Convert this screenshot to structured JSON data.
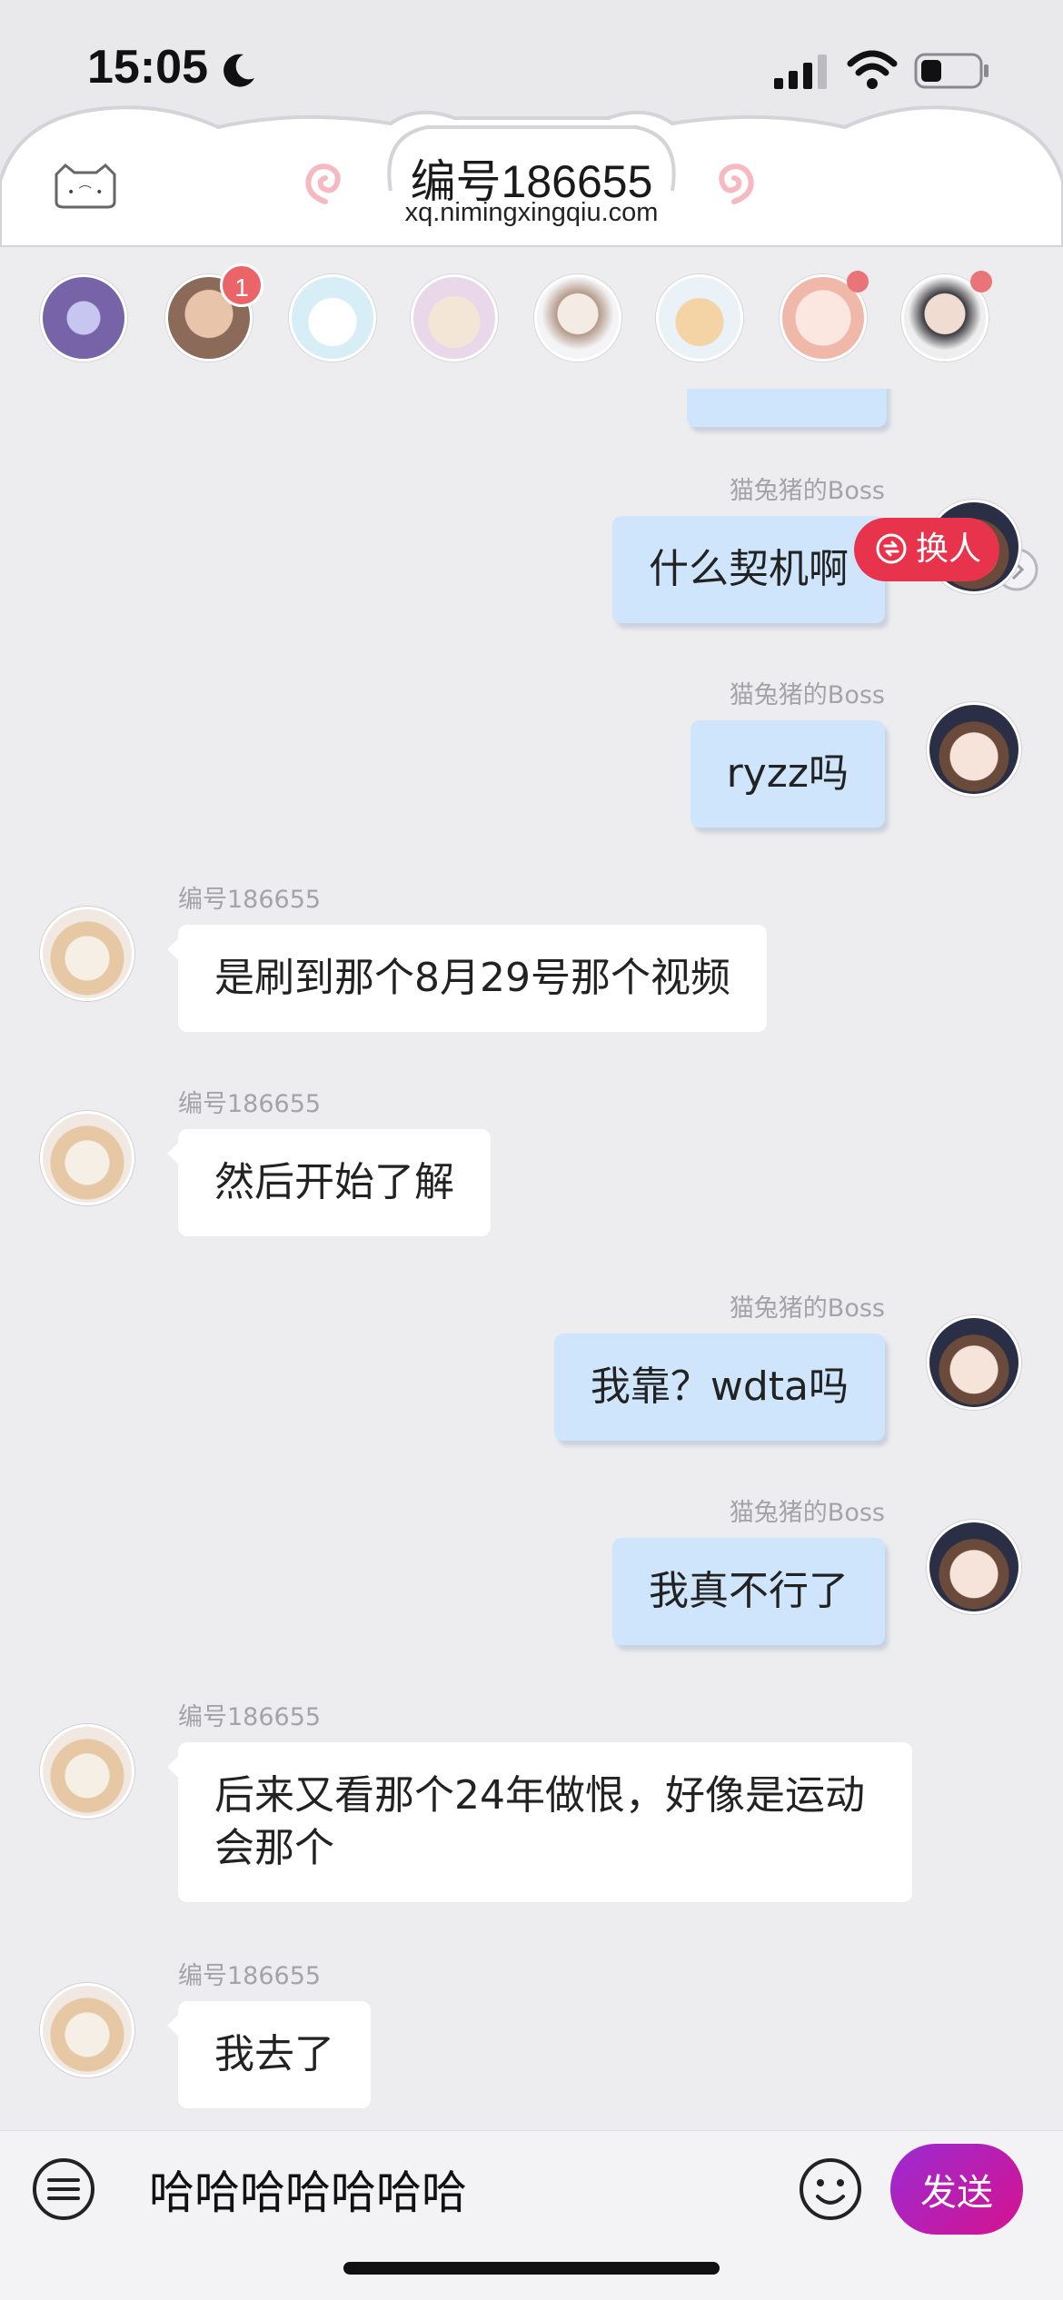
{
  "status_bar": {
    "time": "15:05"
  },
  "header": {
    "title": "编号186655",
    "subtitle": "xq.nimingxingqiu.com"
  },
  "contacts": {
    "unread_badge": "1"
  },
  "chat": {
    "messages": [
      {
        "sender": "猫兔猪的Boss",
        "text": "什么契机啊",
        "side": "me"
      },
      {
        "sender": "猫兔猪的Boss",
        "text": "ryzz吗",
        "side": "me"
      },
      {
        "sender": "编号186655",
        "text": "是刷到那个8月29号那个视频",
        "side": "them"
      },
      {
        "sender": "编号186655",
        "text": "然后开始了解",
        "side": "them"
      },
      {
        "sender": "猫兔猪的Boss",
        "text": "我靠？wdta吗",
        "side": "me"
      },
      {
        "sender": "猫兔猪的Boss",
        "text": "我真不行了",
        "side": "me"
      },
      {
        "sender": "编号186655",
        "text": "后来又看那个24年做恨，好像是运动会那个",
        "side": "them"
      },
      {
        "sender": "编号186655",
        "text": "我去了",
        "side": "them"
      }
    ],
    "switch_label": "换人"
  },
  "composer": {
    "input_value": "哈哈哈哈哈哈哈",
    "send_label": "发送"
  },
  "colors": {
    "my_bubble": "#cfe5fb",
    "their_bubble": "#ffffff",
    "send_gradient_start": "#9a2bd3",
    "send_gradient_end": "#d6128f",
    "switch_badge": "#e8334d"
  }
}
